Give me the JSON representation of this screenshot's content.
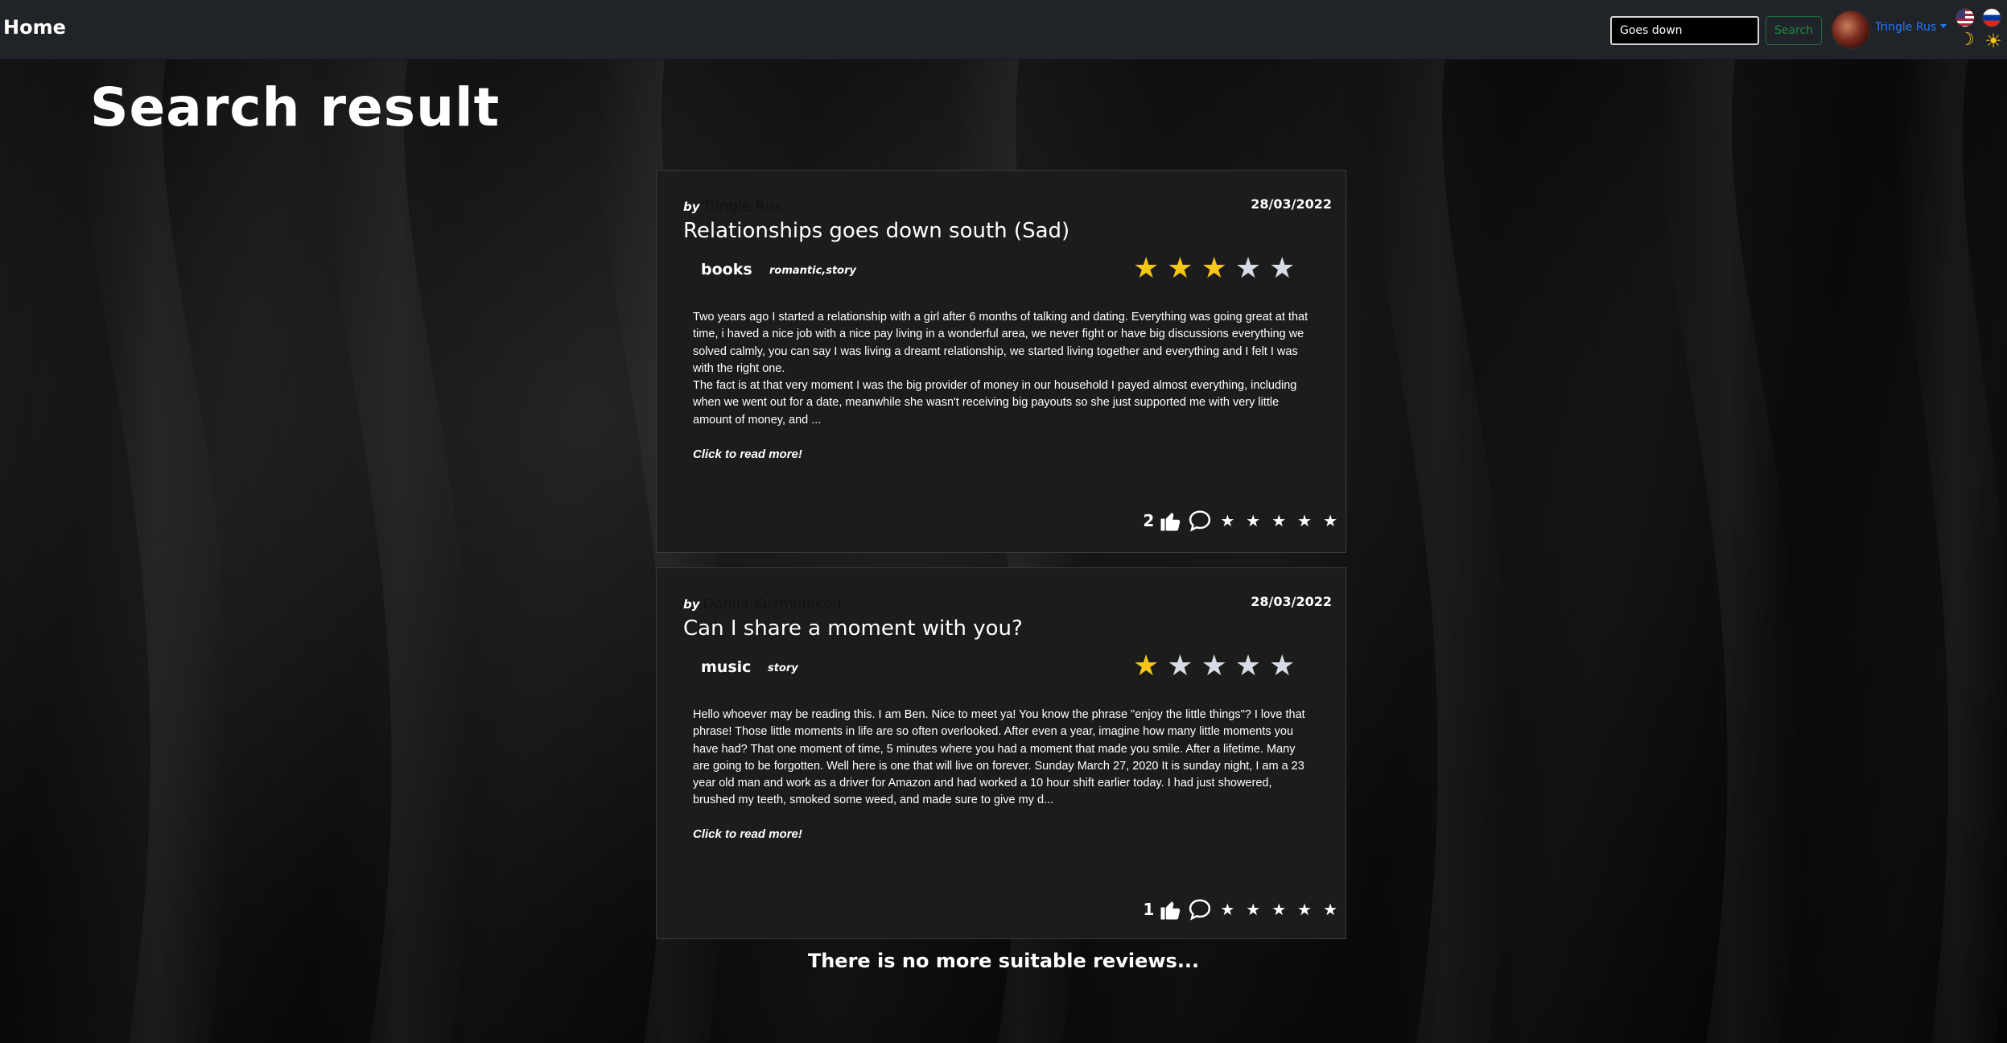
{
  "navbar": {
    "brand": "Home",
    "search_value": "Goes down",
    "search_button": "Search",
    "user_name": "Tringle Rus",
    "icons": [
      "us-flag-icon",
      "ru-flag-icon",
      "moon-icon",
      "sun-icon"
    ]
  },
  "page": {
    "title": "Search result",
    "footer_text": "There is no more suitable reviews..."
  },
  "reviews": [
    {
      "by_label": "by",
      "author": "Tringle Rus",
      "date": "28/03/2022",
      "title": "Relationships goes down south (Sad)",
      "group": "books",
      "tags": "romantic,story",
      "rating": 3,
      "rating_max": 5,
      "body_p1": "Two years ago I started a relationship with a girl after 6 months of talking and dating. Everything was going great at that time, i haved a nice job with a nice pay living in a wonderful area, we never fight or have big discussions everything we solved calmly, you can say I was living a dreamt relationship, we started living together and everything and I felt I was with the right one.",
      "body_p2": "The fact is at that very moment I was the big provider of money in our household I payed almost everything, including when we went out for a date, meanwhile she wasn't receiving big payouts so she just supported me with very little amount of money, and ...",
      "read_more": "Click to read more!",
      "likes": "2"
    },
    {
      "by_label": "by",
      "author": "Danila Kuzmiankou",
      "date": "28/03/2022",
      "title": "Can I share a moment with you?",
      "group": "music",
      "tags": "story",
      "rating": 1,
      "rating_max": 5,
      "body_p1": "Hello whoever may be reading this. I am Ben. Nice to meet ya! You know the phrase \"enjoy the little things\"? I love that phrase! Those little moments in life are so often overlooked. After even a year, imagine how many little moments you have had? That one moment of time, 5 minutes where you had a moment that made you smile. After a lifetime. Many are going to be forgotten. Well here is one that will live on forever. Sunday March 27, 2020 It is sunday night, I am a 23 year old man and work as a driver for Amazon and had worked a 10 hour shift earlier today. I had just showered, brushed my teeth, smoked some weed, and made sure to give my d...",
      "body_p2": "",
      "read_more": "Click to read more!",
      "likes": "1"
    }
  ],
  "colors": {
    "navbar_bg": "#202327",
    "card_bg": "#1c1c1c",
    "star_on": "#f5c518",
    "star_off": "#d7dbe3",
    "link_blue": "#1e7bff",
    "search_btn_green": "#1f8a48"
  }
}
